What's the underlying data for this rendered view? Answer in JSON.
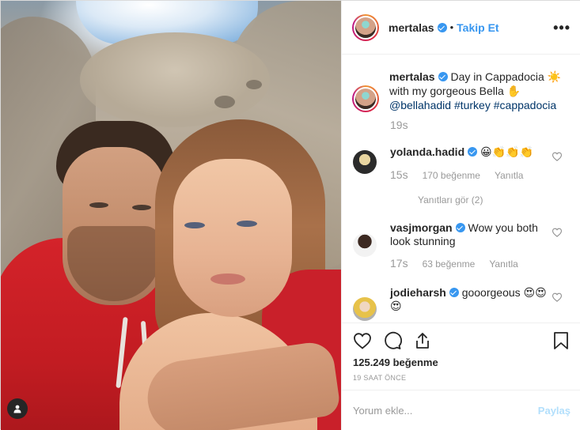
{
  "header": {
    "username": "mertalas",
    "separator": "•",
    "follow_label": "Takip Et",
    "more_label": "•••"
  },
  "caption": {
    "username": "mertalas",
    "text_1": "Day in Cappadocia",
    "sun_emoji": "☀️",
    "text_2": "with my gorgeous Bella",
    "hand_emoji": "✋",
    "mention": "@bellahadid",
    "tag_1": "#turkey",
    "tag_2": "#cappadocia",
    "time": "19s"
  },
  "comments": [
    {
      "username": "yolanda.hadid",
      "text": "😀👏👏👏",
      "time": "15s",
      "likes": "170 beğenme",
      "reply": "Yanıtla",
      "view_replies": "Yanıtları gör (2)"
    },
    {
      "username": "vasjmorgan",
      "text": "Wow you both look stunning",
      "time": "17s",
      "likes": "63 beğenme",
      "reply": "Yanıtla"
    },
    {
      "username": "jodieharsh",
      "text": "gooorgeous 😍😍😍"
    }
  ],
  "actions": {
    "likes": "125.249 beğenme",
    "posted": "19 SAAT ÖNCE"
  },
  "add_comment": {
    "placeholder": "Yorum ekle...",
    "post_label": "Paylaş"
  },
  "colors": {
    "accent": "#3897f0",
    "hashtag": "#003569",
    "muted": "#999999",
    "post_disabled": "#b2dffc"
  },
  "icons": [
    "more-icon",
    "verified-icon",
    "heart-icon",
    "comment-icon",
    "share-icon",
    "bookmark-icon",
    "user-tag-icon"
  ]
}
